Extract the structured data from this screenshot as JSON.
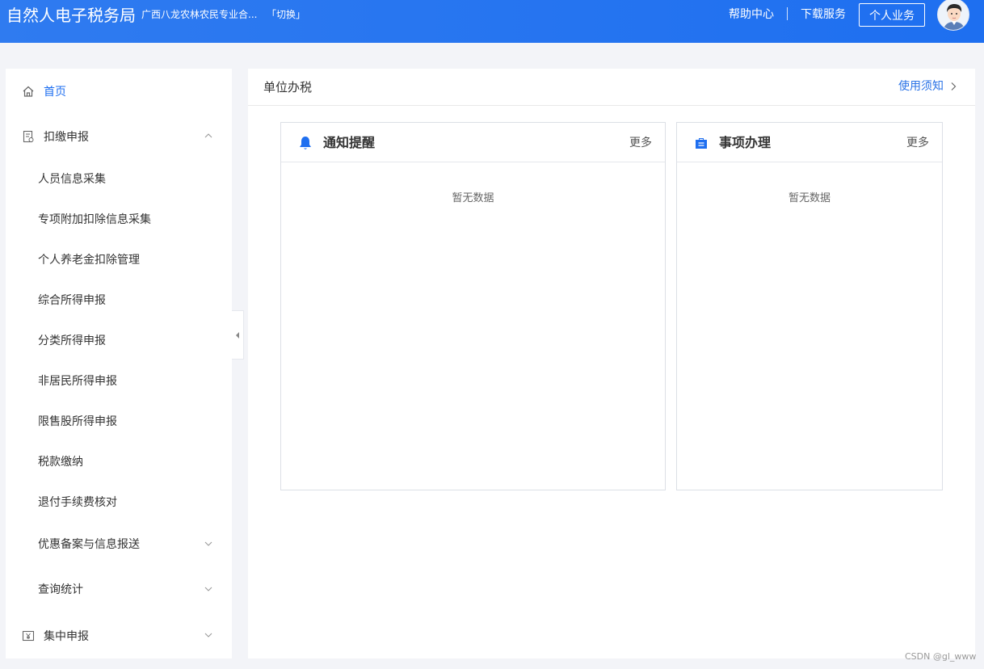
{
  "header": {
    "brand": "自然人电子税务局",
    "company": "广西八龙农林农民专业合...",
    "switch_label": "「切换」",
    "help_label": "帮助中心",
    "download_label": "下载服务",
    "personal_label": "个人业务",
    "accent": "#1e6ff0"
  },
  "sidebar": {
    "home": {
      "label": "首页",
      "icon": "home-icon"
    },
    "declare": {
      "label": "扣缴申报",
      "icon": "document-icon",
      "expanded": true
    },
    "items": [
      "人员信息采集",
      "专项附加扣除信息采集",
      "个人养老金扣除管理",
      "综合所得申报",
      "分类所得申报",
      "非居民所得申报",
      "限售股所得申报",
      "税款缴纳",
      "退付手续费核对",
      "优惠备案与信息报送",
      "查询统计"
    ],
    "central": {
      "label": "集中申报",
      "icon": "yuan-icon"
    }
  },
  "main": {
    "title": "单位办税",
    "notice_label": "使用须知",
    "cards": [
      {
        "title": "通知提醒",
        "more": "更多",
        "empty": "暂无数据",
        "icon": "bell-icon"
      },
      {
        "title": "事项办理",
        "more": "更多",
        "empty": "暂无数据",
        "icon": "briefcase-icon"
      }
    ]
  },
  "watermark": "CSDN @gl_www"
}
